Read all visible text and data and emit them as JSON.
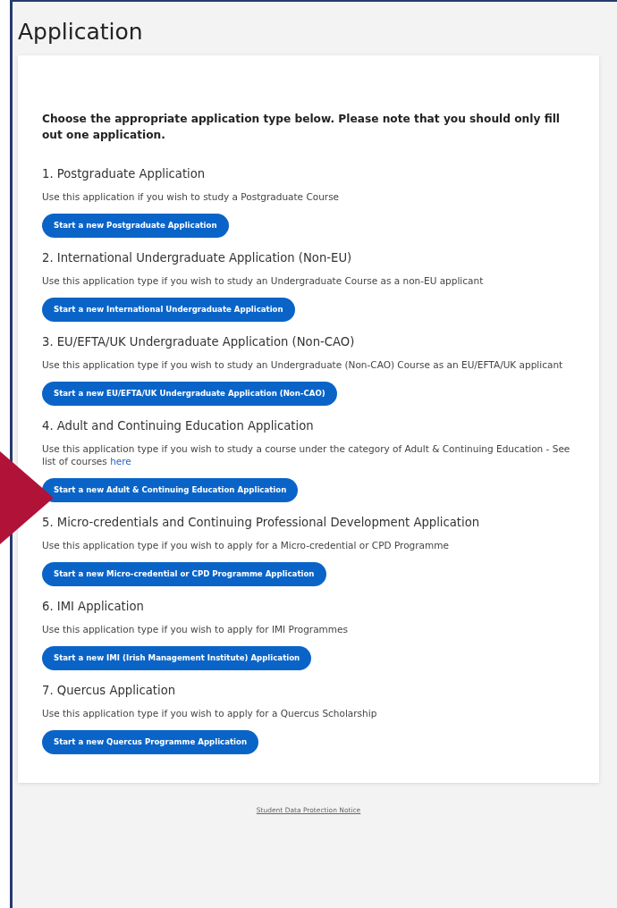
{
  "page_title": "Application",
  "intro": "Choose the appropriate application type below. Please note that you should only fill out one application.",
  "applications": [
    {
      "title": "1. Postgraduate Application",
      "description": "Use this application if you wish to study a Postgraduate Course",
      "button": "Start a new Postgraduate Application"
    },
    {
      "title": "2. International Undergraduate Application (Non-EU)",
      "description": "Use this application type if you wish to study an Undergraduate Course as a non-EU applicant",
      "button": "Start a new International Undergraduate Application"
    },
    {
      "title": "3. EU/EFTA/UK Undergraduate Application (Non-CAO)",
      "description": "Use this application type if you wish to study an Undergraduate (Non-CAO) Course as an EU/EFTA/UK applicant",
      "button": "Start a new EU/EFTA/UK Undergraduate Application (Non-CAO)"
    },
    {
      "title": "4. Adult and Continuing Education Application",
      "description": "Use this application type if you wish to study a course under the category of Adult & Continuing Education - See list of courses",
      "link": "here",
      "button": "Start a new Adult & Continuing Education Application"
    },
    {
      "title": "5. Micro-credentials and Continuing Professional Development Application",
      "description": "Use this application type if you wish to apply for a Micro-credential or CPD Programme",
      "button": "Start a new Micro-credential or CPD Programme Application"
    },
    {
      "title": "6. IMI Application",
      "description": "Use this application type if you wish to apply for IMI Programmes",
      "button": "Start a new IMI (Irish Management Institute) Application"
    },
    {
      "title": "7. Quercus Application",
      "description": "Use this application type if you wish to apply for a Quercus Scholarship",
      "button": "Start a new Quercus Programme Application"
    }
  ],
  "footer_link": "Student Data Protection Notice"
}
